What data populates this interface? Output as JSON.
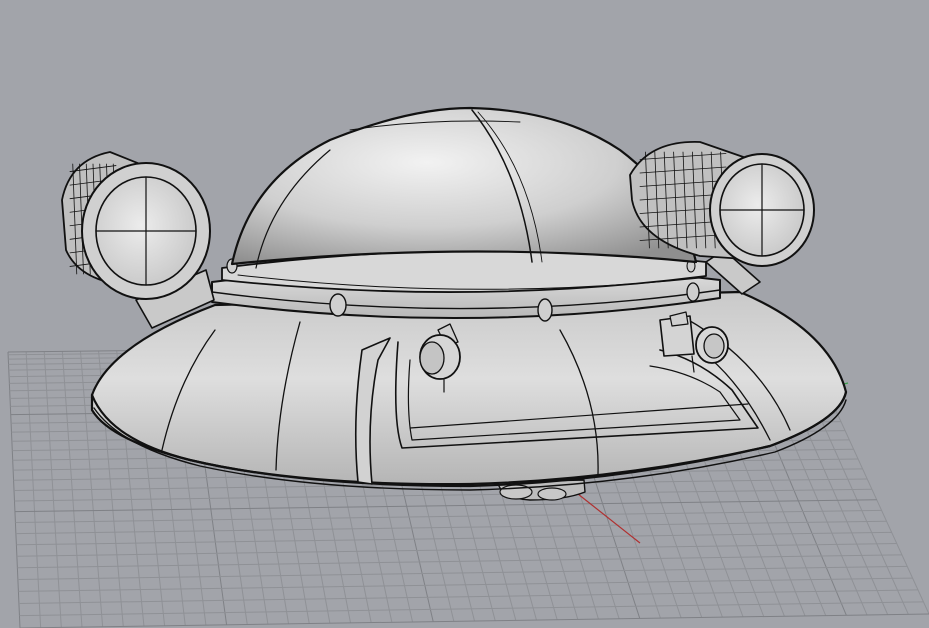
{
  "viewport": {
    "background_color": "#a2a4aa",
    "grid_color": "#8f9196",
    "grid_major_color": "#7f8186",
    "model_fill": "#dcdcdc",
    "model_shadow": "#9a9a9a",
    "edge_color": "#111111",
    "x_axis_color": "#b03030",
    "y_axis_color": "#3aa04a"
  },
  "model": {
    "object": "saucer-spaceship",
    "display_mode": "shaded-with-edges"
  }
}
